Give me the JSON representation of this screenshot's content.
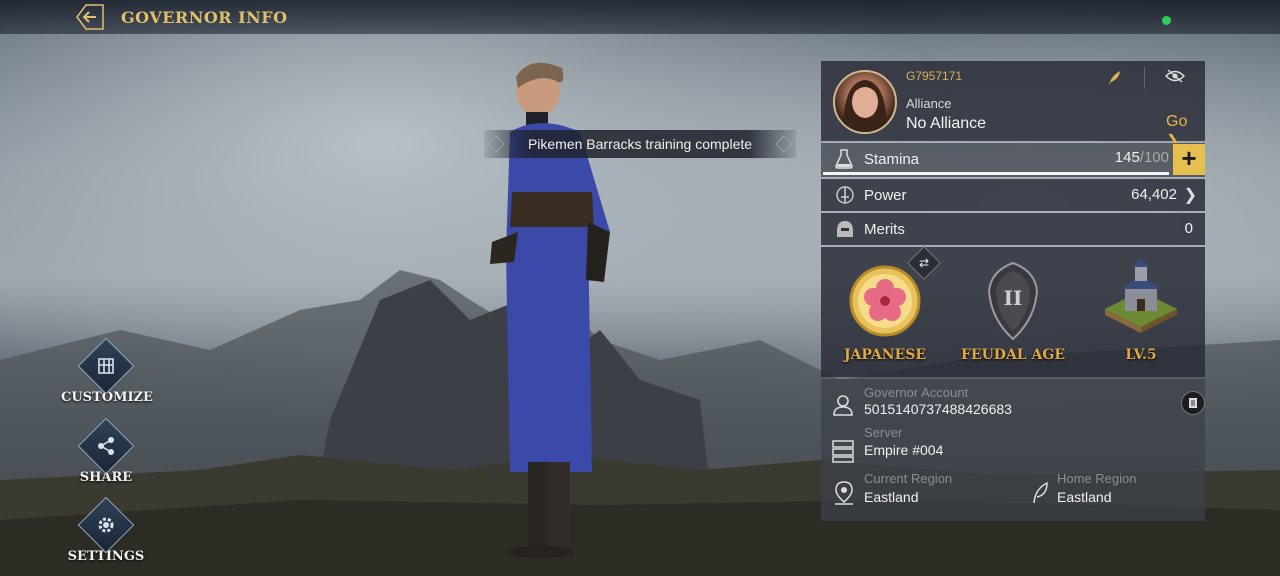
{
  "header": {
    "title": "GOVERNOR INFO"
  },
  "toast": {
    "text": "Pikemen Barracks training complete"
  },
  "side_buttons": [
    {
      "label": "CUSTOMIZE",
      "icon": "customize-icon"
    },
    {
      "label": "SHARE",
      "icon": "share-icon"
    },
    {
      "label": "SETTINGS",
      "icon": "gear-icon"
    }
  ],
  "panel": {
    "player_id": "G7957171",
    "alliance_label": "Alliance",
    "alliance_value": "No Alliance",
    "go_label": "Go",
    "stamina": {
      "label": "Stamina",
      "value": "145",
      "max": "/100",
      "fill_fraction": 1.0
    },
    "power": {
      "label": "Power",
      "value": "64,402"
    },
    "merits": {
      "label": "Merits",
      "value": "0"
    },
    "badges": [
      {
        "label": "JAPANESE",
        "icon": "sakura-emblem-icon"
      },
      {
        "label": "FEUDAL AGE",
        "icon": "age-shield-icon"
      },
      {
        "label": "LV.5",
        "icon": "castle-icon"
      }
    ],
    "account": {
      "label": "Governor Account",
      "value": "5015140737488426683"
    },
    "server": {
      "label": "Server",
      "value": "Empire #004"
    },
    "current_region": {
      "label": "Current Region",
      "value": "Eastland"
    },
    "home_region": {
      "label": "Home Region",
      "value": "Eastland"
    }
  },
  "colors": {
    "accent_gold": "#e2bf6b",
    "badge_orange": "#e1a740",
    "stamina_button": "#e6c04e",
    "status_green": "#2ed05a"
  }
}
